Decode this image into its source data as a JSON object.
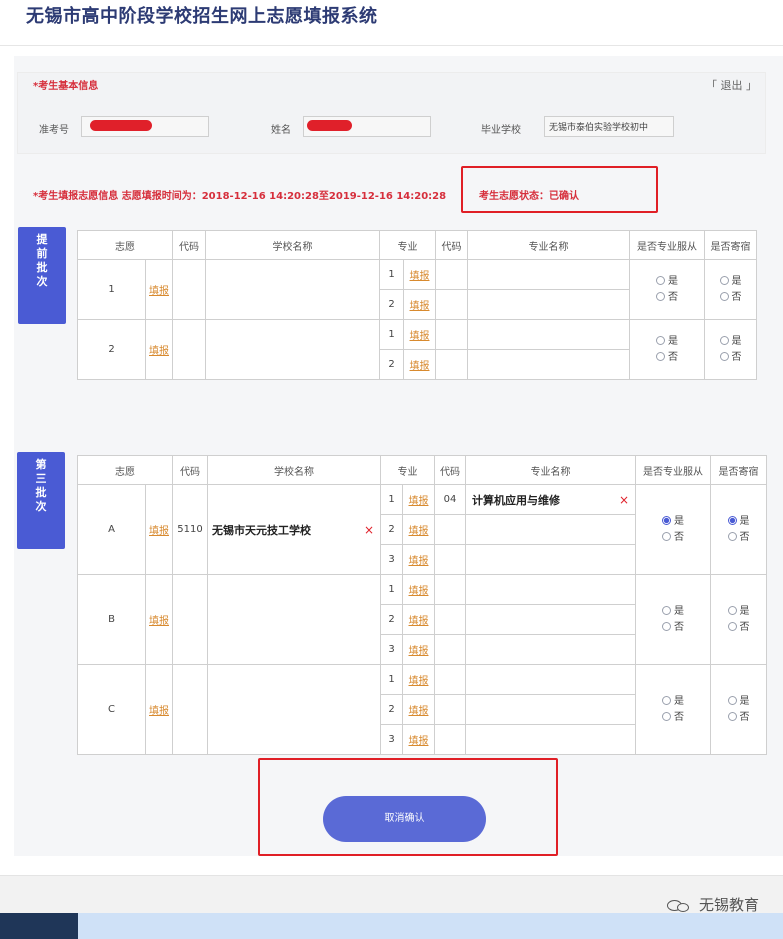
{
  "header": {
    "title": "无锡市高中阶段学校招生网上志愿填报系统"
  },
  "basic": {
    "title": "*考生基本信息",
    "logout": "「 退出 」",
    "exam_no_label": "准考号",
    "name_label": "姓名",
    "school_label": "毕业学校",
    "school_value": "无锡市泰伯实验学校初中"
  },
  "application": {
    "info_text": "*考生填报志愿信息  志愿填报时间为：2018-12-16 14:20:28至2019-12-16 14:20:28",
    "status_text": "考生志愿状态：已确认"
  },
  "headers": [
    "志愿",
    "代码",
    "学校名称",
    "专业",
    "代码",
    "专业名称",
    "是否专业服从",
    "是否寄宿"
  ],
  "fill_label": "填报",
  "yes_label": "是",
  "no_label": "否",
  "early_batch": {
    "tab": "提前批次",
    "rows": [
      {
        "no": "1",
        "majors": [
          "1",
          "2"
        ]
      },
      {
        "no": "2",
        "majors": [
          "1",
          "2"
        ]
      }
    ]
  },
  "third_batch": {
    "tab": "第三批次",
    "rows": [
      {
        "no": "A",
        "code": "5110",
        "school": "无锡市天元技工学校",
        "majors": [
          "1",
          "2",
          "3"
        ],
        "major1_code": "04",
        "major1_name": "计算机应用与维修"
      },
      {
        "no": "B",
        "majors": [
          "1",
          "2",
          "3"
        ]
      },
      {
        "no": "C",
        "majors": [
          "1",
          "2",
          "3"
        ]
      }
    ]
  },
  "cancel_button": "取消确认",
  "watermark": "无锡教育",
  "colors": {
    "accent": "#4a5bd4",
    "alert": "#d62f3c",
    "link": "#d88a2f"
  }
}
